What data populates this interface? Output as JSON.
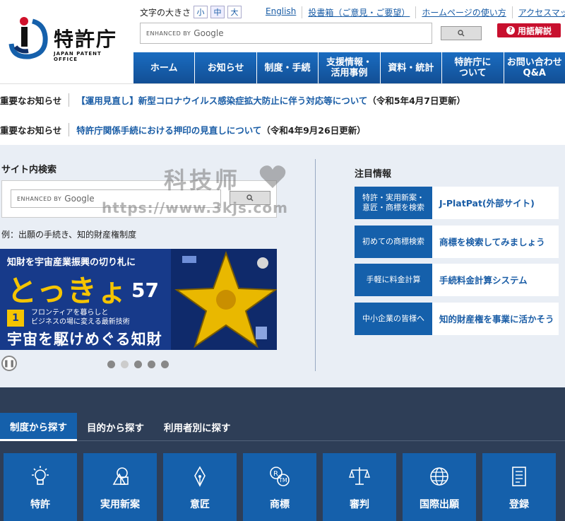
{
  "header": {
    "logo_name": "特許庁",
    "logo_sub": "JAPAN PATENT OFFICE",
    "font_size_label": "文字の大きさ",
    "font_sizes": [
      "小",
      "中",
      "大"
    ],
    "top_links": [
      "English",
      "投書箱（ご意見・ご要望）",
      "ホームページの使い方",
      "アクセスマップ"
    ],
    "search_enhanced": "ENHANCED BY",
    "search_google": "Google",
    "search_button_icon": "magnifier-icon",
    "glossary_label": "用語解説"
  },
  "nav": {
    "items": [
      "ホーム",
      "お知らせ",
      "制度・手続",
      "支援情報・\n活用事例",
      "資料・統計",
      "特許庁に\nついて",
      "お問い合わせ\nQ&A"
    ]
  },
  "notices": [
    {
      "label": "重要なお知らせ",
      "link": "【運用見直し】新型コロナウイルス感染症拡大防止に伴う対応等について",
      "date": "（令和5年4月7日更新）"
    },
    {
      "label": "重要なお知らせ",
      "link": "特許庁関係手続における押印の見直しについて",
      "date": "（令和4年9月26日更新）"
    }
  ],
  "site_search": {
    "title": "サイト内検索",
    "enhanced": "ENHANCED BY",
    "google": "Google",
    "example": "例：出願の手続き、知的財産権制度"
  },
  "banner": {
    "top": "知財を宇宙産業振興の切り札に",
    "title": "とっきょ",
    "number": "57",
    "badge": "1",
    "feature_line1": "フロンティアを暮らしと",
    "feature_line2": "ビジネスの場に変える最新技術",
    "bottom": "宇宙を駆けめぐる知財"
  },
  "carousel": {
    "pause_icon": "pause-icon",
    "slide_count": 5,
    "active_slide": 1
  },
  "featured": {
    "title": "注目情報",
    "rows": [
      {
        "label": "特許・実用新案・\n意匠・商標を検索",
        "value": "J-PlatPat(外部サイト)"
      },
      {
        "label": "初めての商標検索",
        "value": "商標を検索してみましょう"
      },
      {
        "label": "手軽に料金計算",
        "value": "手続料金計算システム"
      },
      {
        "label": "中小企業の皆様へ",
        "value": "知的財産権を事業に活かそう"
      }
    ]
  },
  "categories": {
    "tabs": [
      "制度から探す",
      "目的から探す",
      "利用者別に探す"
    ],
    "active_tab": 0,
    "cards": [
      {
        "label": "特許",
        "icon": "lightbulb-icon"
      },
      {
        "label": "実用新案",
        "icon": "shapes-icon"
      },
      {
        "label": "意匠",
        "icon": "pen-nib-icon"
      },
      {
        "label": "商標",
        "icon": "trademark-icon"
      },
      {
        "label": "審判",
        "icon": "scales-icon"
      },
      {
        "label": "国際出願",
        "icon": "globe-icon"
      },
      {
        "label": "登録",
        "icon": "document-icon"
      }
    ]
  },
  "watermark": {
    "line1": "科技师",
    "line2": "https://www.3kjs.com"
  },
  "colors": {
    "primary_blue": "#1560ab",
    "dark_band": "#2e3e57",
    "light_band": "#e9eef5",
    "glossary_red": "#c8102e",
    "banner_yellow": "#f5c400"
  }
}
